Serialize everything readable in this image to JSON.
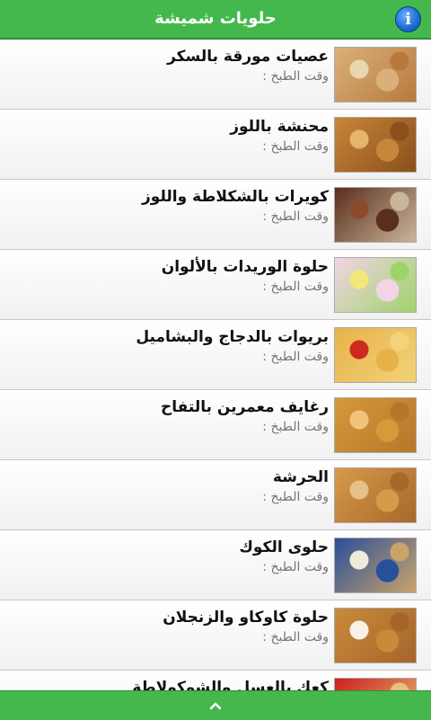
{
  "header": {
    "title": "حلويات شميشة",
    "info_icon": "info-icon"
  },
  "recipes": [
    {
      "name": "عصيات مورقة بالسكر",
      "time": "وقت الطبخ :",
      "colors": [
        "#d9b07a",
        "#e8d6b0",
        "#b87a3c"
      ]
    },
    {
      "name": "محنشة باللوز",
      "time": "وقت الطبخ :",
      "colors": [
        "#c8863a",
        "#e6b56a",
        "#8a4f1c"
      ]
    },
    {
      "name": "كويرات بالشكلاطة واللوز",
      "time": "وقت الطبخ :",
      "colors": [
        "#5a2e1c",
        "#8b4a2c",
        "#c9b59a"
      ]
    },
    {
      "name": "حلوة الوريدات بالألوان",
      "time": "وقت الطبخ :",
      "colors": [
        "#f1d4e6",
        "#f4e77a",
        "#9fd36a"
      ]
    },
    {
      "name": "بريوات بالدجاج والبشاميل",
      "time": "وقت الطبخ :",
      "colors": [
        "#e7b24a",
        "#cc2a1e",
        "#f2d27a"
      ]
    },
    {
      "name": "رغايف معمرين بالتفاح",
      "time": "وقت الطبخ :",
      "colors": [
        "#d59a3a",
        "#f0c57a",
        "#b8752a"
      ]
    },
    {
      "name": "الحرشة",
      "time": "وقت الطبخ :",
      "colors": [
        "#d69a4a",
        "#e8c08a",
        "#a8682a"
      ]
    },
    {
      "name": "حلوى الكوك",
      "time": "وقت الطبخ :",
      "colors": [
        "#2a4f9a",
        "#f0ead8",
        "#c9a36a"
      ]
    },
    {
      "name": "حلوة كاوكاو والزنجلان",
      "time": "وقت الطبخ :",
      "colors": [
        "#c98a3a",
        "#f7f1e6",
        "#a5652a"
      ]
    },
    {
      "name": "كعك بالعسل والشوكولاطة",
      "time": "",
      "colors": [
        "#cc1e1e",
        "#7a3a1a",
        "#e8c07a"
      ]
    }
  ],
  "footer": {
    "expand_icon": "chevron-up-icon"
  }
}
